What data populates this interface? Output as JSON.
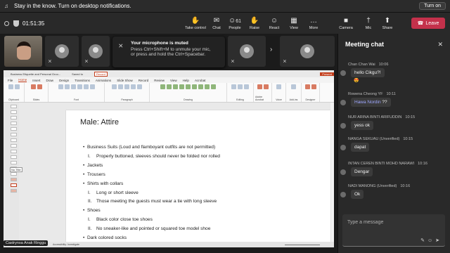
{
  "banner": {
    "text": "Stay in the know. Turn on desktop notifications.",
    "button": "Turn on"
  },
  "meeting": {
    "timer": "01:51:35"
  },
  "toolbar": {
    "items": [
      {
        "label": "Take control",
        "icon": "✋"
      },
      {
        "label": "Chat",
        "icon": "✉"
      },
      {
        "label": "People",
        "icon": "☺",
        "count": "61"
      },
      {
        "label": "Raise",
        "icon": "✋"
      },
      {
        "label": "React",
        "icon": "☺"
      },
      {
        "label": "View",
        "icon": "▦"
      },
      {
        "label": "More",
        "icon": "…"
      },
      {
        "label": "Camera",
        "icon": "■"
      },
      {
        "label": "Mic",
        "icon": "†"
      },
      {
        "label": "Share",
        "icon": "⬆"
      }
    ],
    "leave": "Leave"
  },
  "toast": {
    "title": "Your microphone is muted",
    "line1": "Press Ctrl+Shift+M to unmute your mic,",
    "line2": "or press and hold the Ctrl+Spacebar."
  },
  "presenter": {
    "name": "Castrynsa Anak Ringgu"
  },
  "ppt": {
    "filename": "Business Etiquette and Personal Groo...",
    "saved": "Saved to ",
    "record": "Record",
    "present": "Present",
    "tabs": [
      "File",
      "Home",
      "Insert",
      "Draw",
      "Design",
      "Transitions",
      "Animations",
      "Slide Show",
      "Record",
      "Review",
      "View",
      "Help",
      "Acrobat"
    ],
    "active_tab": "Home",
    "ribbon_groups": [
      "Clipboard",
      "Slides",
      "Font",
      "Paragraph",
      "Drawing",
      "Editing",
      "Adobe Acrobat",
      "Voice",
      "Add-ins",
      "Designer"
    ],
    "tooltip": "No Title",
    "status": "Accessibility: Investigate"
  },
  "slide": {
    "title": "Male: Attire",
    "lines": [
      "Business Suits (Loud and flamboyant outfits are not permitted)",
      "Properly buttoned, sleeves should never be folded nor rolled",
      "Jackets",
      "Trousers",
      "Shirts with collars",
      "Long or short sleeve",
      "Those meeting the guests must wear a tie with long sleeve",
      "Shoes",
      "Black color close toe shoes",
      "No sneaker-like and pointed  or squared toe model shoe",
      "Dark colored socks"
    ],
    "markers": [
      "•",
      "I.",
      "•",
      "•",
      "•",
      "I.",
      "II.",
      "•",
      "I.",
      "II.",
      "•"
    ]
  },
  "chat": {
    "title": "Meeting chat",
    "messages": [
      {
        "sender": "Chan Chan Wai",
        "time": "10:06",
        "text": "hello Cikgu?!",
        "reaction": "😍"
      },
      {
        "sender": "Rowena Cheong YF",
        "time": "10:11",
        "mention": "Hawa Nordin",
        "text": " ??"
      },
      {
        "sender": "NUR ARINA BINTI ARIFUDDIN",
        "time": "10:15",
        "text": "yess ok"
      },
      {
        "sender": "NANGA SEKUAU (Unverified)",
        "time": "10:15",
        "text": "dapat"
      },
      {
        "sender": "INTAN CEREN BINTI MOHD NARAWI",
        "time": "10:16",
        "text": "Dengar"
      },
      {
        "sender": "NADI MANONG (Unverified)",
        "time": "10:16",
        "text": "Ok"
      }
    ],
    "placeholder": "Type a message"
  }
}
